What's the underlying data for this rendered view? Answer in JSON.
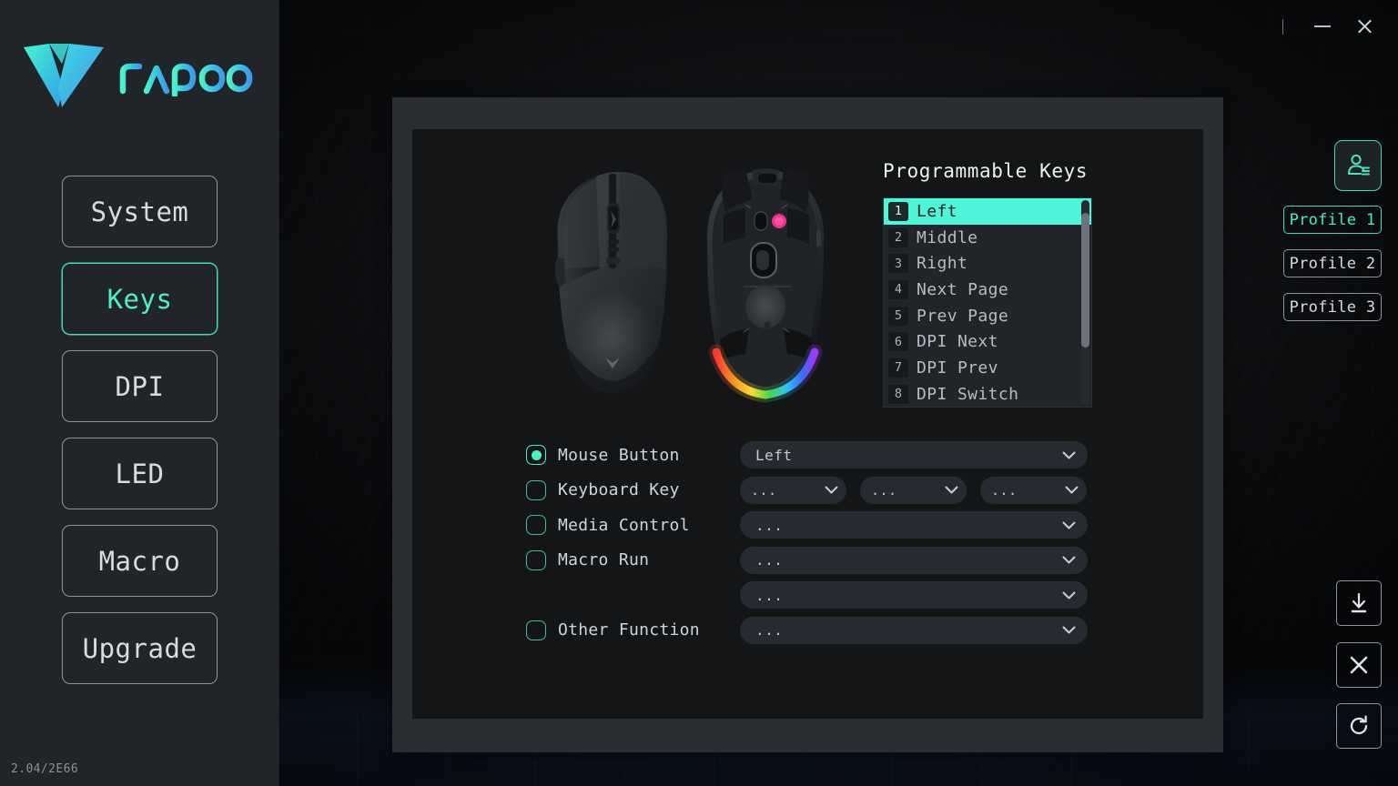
{
  "app": {
    "brand": "rapoo",
    "version": "2.04/2E66"
  },
  "titlebar": {
    "minimize_label": "Minimize",
    "close_label": "Close"
  },
  "sidebar": {
    "items": [
      {
        "label": "System",
        "active": false
      },
      {
        "label": "Keys",
        "active": true
      },
      {
        "label": "DPI",
        "active": false
      },
      {
        "label": "LED",
        "active": false
      },
      {
        "label": "Macro",
        "active": false
      },
      {
        "label": "Upgrade",
        "active": false
      }
    ]
  },
  "main": {
    "device_image_alt": "gaming-mouse-top-and-bottom-view",
    "programmable_keys": {
      "title": "Programmable Keys",
      "rows": [
        {
          "num": "1",
          "label": "Left",
          "selected": true
        },
        {
          "num": "2",
          "label": "Middle",
          "selected": false
        },
        {
          "num": "3",
          "label": "Right",
          "selected": false
        },
        {
          "num": "4",
          "label": "Next Page",
          "selected": false
        },
        {
          "num": "5",
          "label": "Prev Page",
          "selected": false
        },
        {
          "num": "6",
          "label": "DPI Next",
          "selected": false
        },
        {
          "num": "7",
          "label": "DPI Prev",
          "selected": false
        },
        {
          "num": "8",
          "label": "DPI Switch",
          "selected": false
        }
      ]
    },
    "assignments": [
      {
        "label": "Mouse Button",
        "checked": true,
        "controls": [
          {
            "value": "Left",
            "width": "wide"
          }
        ]
      },
      {
        "label": "Keyboard Key",
        "checked": false,
        "controls": [
          {
            "value": "...",
            "width": "third"
          },
          {
            "value": "...",
            "width": "third"
          },
          {
            "value": "...",
            "width": "third"
          }
        ]
      },
      {
        "label": "Media Control",
        "checked": false,
        "controls": [
          {
            "value": "...",
            "width": "wide"
          }
        ]
      },
      {
        "label": "Macro Run",
        "checked": false,
        "controls": [
          {
            "value": "...",
            "width": "wide"
          }
        ]
      },
      {
        "label": "",
        "checked": null,
        "controls": [
          {
            "value": "...",
            "width": "wide"
          }
        ]
      },
      {
        "label": "Other Function",
        "checked": false,
        "controls": [
          {
            "value": "...",
            "width": "wide"
          }
        ]
      }
    ]
  },
  "rail": {
    "profile_icon_name": "user-profile-icon",
    "profiles": [
      {
        "label": "Profile 1",
        "active": true
      },
      {
        "label": "Profile 2",
        "active": false
      },
      {
        "label": "Profile 3",
        "active": false
      }
    ],
    "actions": [
      {
        "name": "save-download-button",
        "icon": "download-icon"
      },
      {
        "name": "cancel-button",
        "icon": "close-x-icon"
      },
      {
        "name": "reset-refresh-button",
        "icon": "refresh-icon"
      }
    ]
  },
  "colors": {
    "accent": "#4ef0c6",
    "accent_bright": "#4ef5d8",
    "sidebar_bg": "#212428",
    "panel_outer": "#2a2e33",
    "panel_inner": "#141517",
    "text": "#d4dadd",
    "muted": "#8b9297"
  }
}
